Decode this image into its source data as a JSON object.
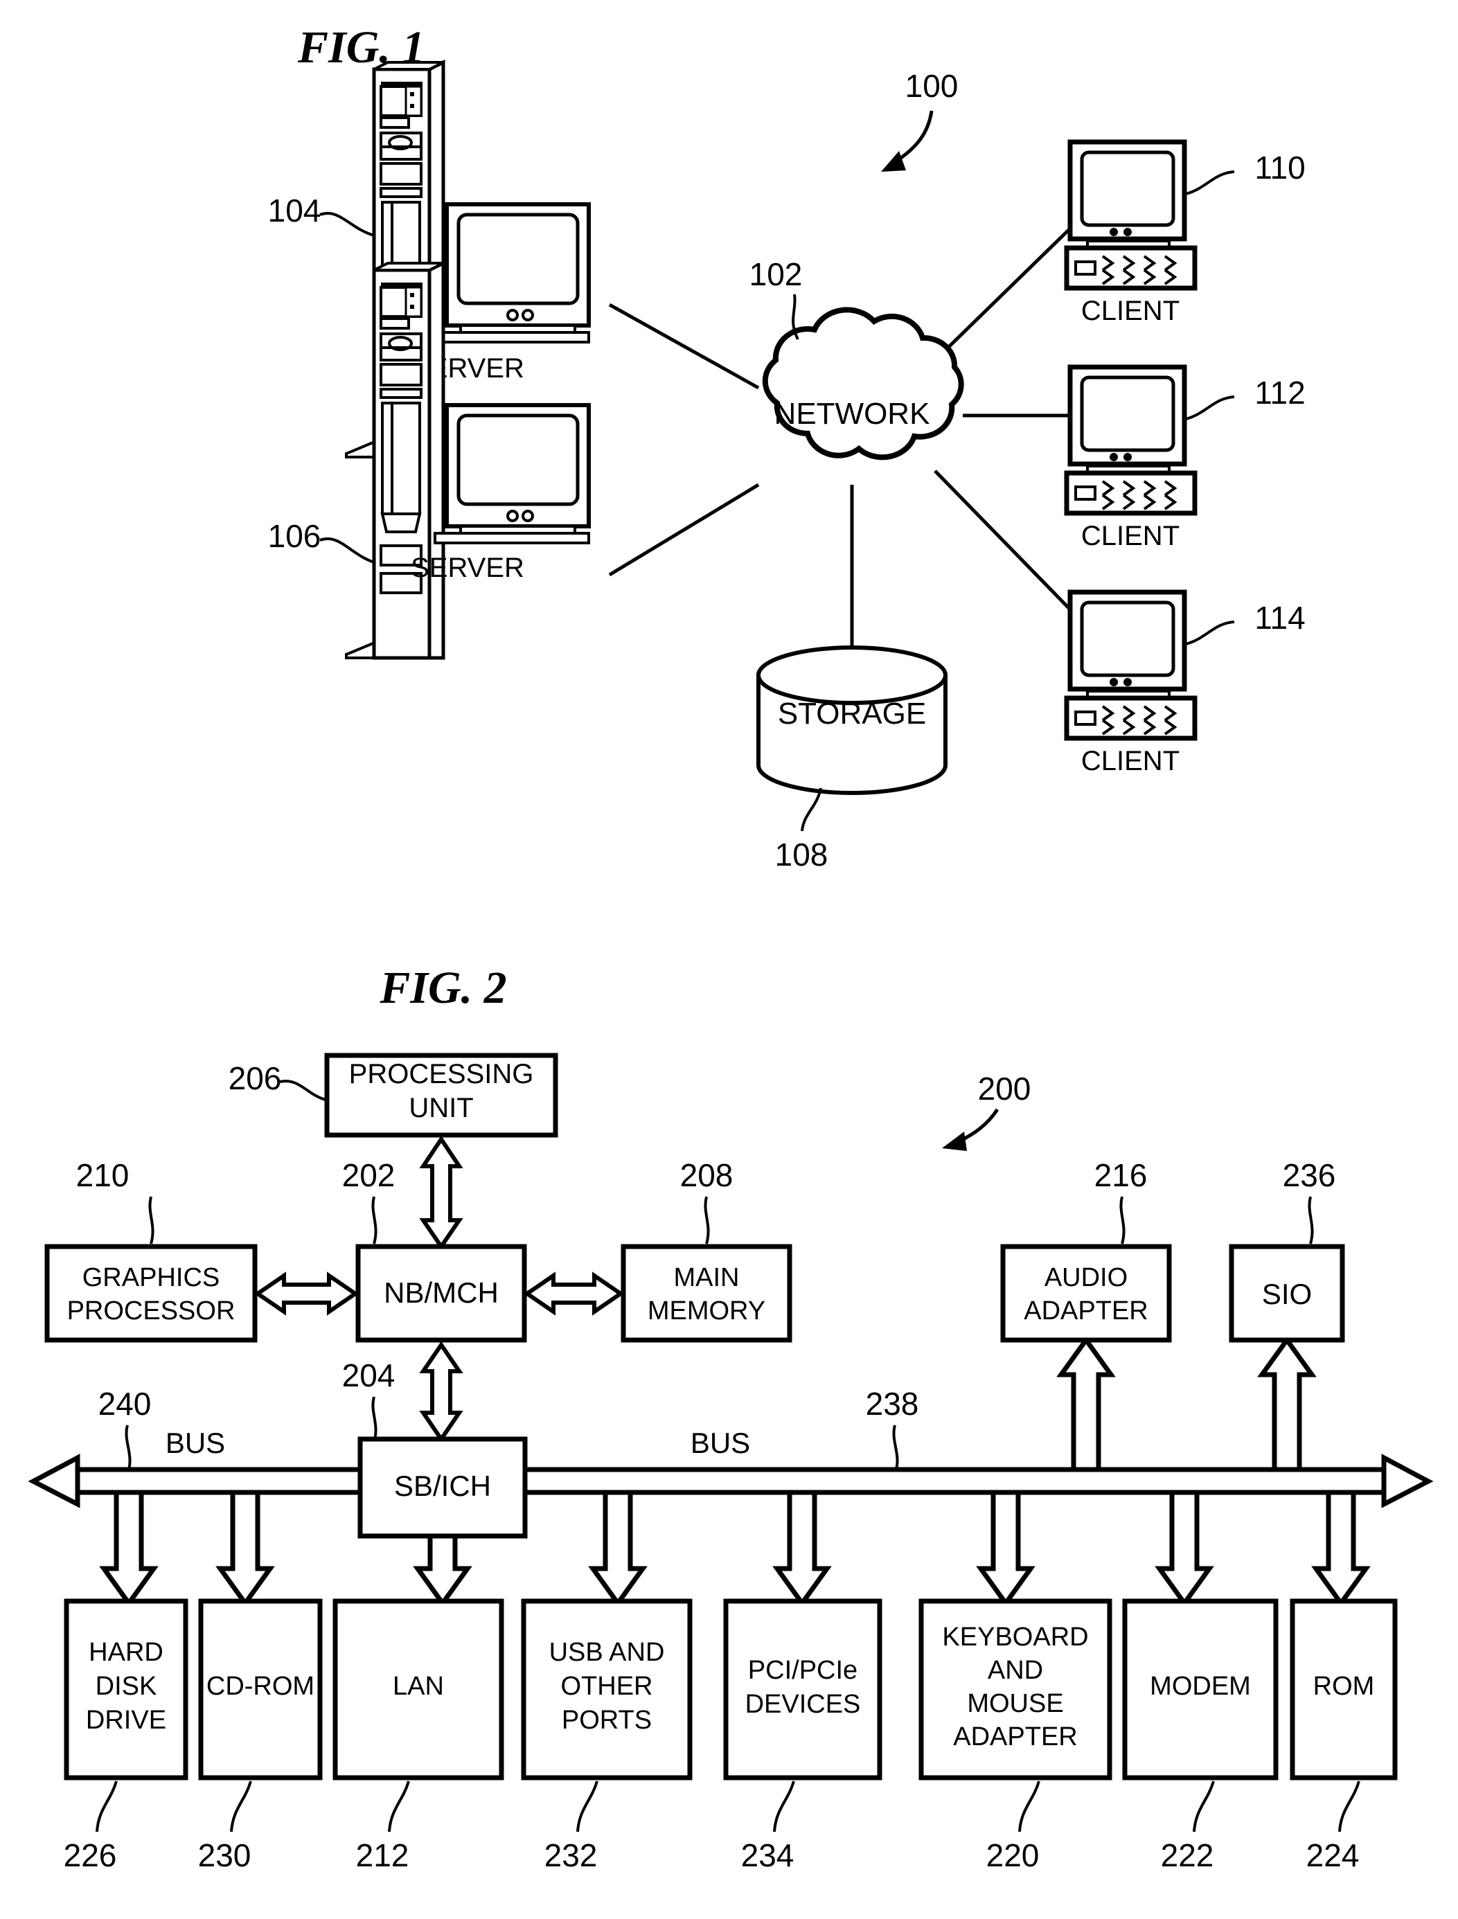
{
  "figures": [
    {
      "id": "fig1",
      "title": "FIG. 1",
      "system_ref": "100",
      "nodes": [
        {
          "name": "server-1",
          "label": "SERVER",
          "ref": "104"
        },
        {
          "name": "server-2",
          "label": "SERVER",
          "ref": "106"
        },
        {
          "name": "network-cloud",
          "label": "NETWORK",
          "ref": "102"
        },
        {
          "name": "storage",
          "label": "STORAGE",
          "ref": "108"
        },
        {
          "name": "client-1",
          "label": "CLIENT",
          "ref": "110"
        },
        {
          "name": "client-2",
          "label": "CLIENT",
          "ref": "112"
        },
        {
          "name": "client-3",
          "label": "CLIENT",
          "ref": "114"
        }
      ]
    },
    {
      "id": "fig2",
      "title": "FIG. 2",
      "system_ref": "200",
      "blocks": [
        {
          "name": "processing-unit",
          "label": "PROCESSING UNIT",
          "lines": [
            "PROCESSING",
            "UNIT"
          ],
          "ref": "206"
        },
        {
          "name": "nb-mch",
          "label": "NB/MCH",
          "lines": [
            "NB/MCH"
          ],
          "ref": "202"
        },
        {
          "name": "graphics-processor",
          "label": "GRAPHICS PROCESSOR",
          "lines": [
            "GRAPHICS",
            "PROCESSOR"
          ],
          "ref": "210"
        },
        {
          "name": "main-memory",
          "label": "MAIN MEMORY",
          "lines": [
            "MAIN",
            "MEMORY"
          ],
          "ref": "208"
        },
        {
          "name": "audio-adapter",
          "label": "AUDIO ADAPTER",
          "lines": [
            "AUDIO",
            "ADAPTER"
          ],
          "ref": "216"
        },
        {
          "name": "sio",
          "label": "SIO",
          "lines": [
            "SIO"
          ],
          "ref": "236"
        },
        {
          "name": "sb-ich",
          "label": "SB/ICH",
          "lines": [
            "SB/ICH"
          ],
          "ref": "204"
        },
        {
          "name": "hard-disk-drive",
          "label": "HARD DISK DRIVE",
          "lines": [
            "HARD",
            "DISK",
            "DRIVE"
          ],
          "ref": "226"
        },
        {
          "name": "cd-rom",
          "label": "CD-ROM",
          "lines": [
            "CD-ROM"
          ],
          "ref": "230"
        },
        {
          "name": "lan",
          "label": "LAN",
          "lines": [
            "LAN"
          ],
          "ref": "212"
        },
        {
          "name": "usb-and-other-ports",
          "label": "USB AND OTHER PORTS",
          "lines": [
            "USB AND",
            "OTHER",
            "PORTS"
          ],
          "ref": "232"
        },
        {
          "name": "pci-pcie-devices",
          "label": "PCI/PCIe DEVICES",
          "lines": [
            "PCI/PCIe",
            "DEVICES"
          ],
          "ref": "234"
        },
        {
          "name": "keyboard-and-mouse-adapter",
          "label": "KEYBOARD AND MOUSE ADAPTER",
          "lines": [
            "KEYBOARD",
            "AND",
            "MOUSE",
            "ADAPTER"
          ],
          "ref": "220"
        },
        {
          "name": "modem",
          "label": "MODEM",
          "lines": [
            "MODEM"
          ],
          "ref": "222"
        },
        {
          "name": "rom",
          "label": "ROM",
          "lines": [
            "ROM"
          ],
          "ref": "224"
        }
      ],
      "bus_left_label": "BUS",
      "bus_right_label": "BUS",
      "bus_left_ref": "240",
      "bus_right_ref": "238"
    }
  ],
  "colors": {
    "ink": "#000000",
    "paper": "#ffffff"
  }
}
